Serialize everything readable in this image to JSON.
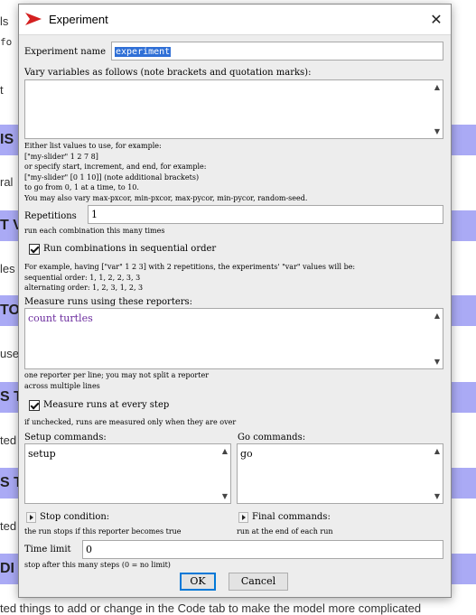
{
  "background": {
    "fragments": [
      "ls",
      "fo",
      "t",
      "ral",
      "les",
      "use",
      "ted",
      "ted"
    ],
    "bands": [
      "IS",
      "T V",
      "TO",
      "S T",
      "S T",
      "DI"
    ],
    "bottom_text": "ted things to add or change in the Code tab to make the model more complicated"
  },
  "dialog": {
    "title": "Experiment",
    "close_glyph": "✕"
  },
  "experiment_name": {
    "label": "Experiment name",
    "value": "experiment"
  },
  "vary_variables": {
    "label": "Vary variables as follows (note brackets and quotation marks):",
    "value": "",
    "help": "Either list values to use, for example:\n[\"my-slider\" 1 2 7 8]\nor specify start, increment, and end, for example:\n[\"my-slider\" [0 1 10]] (note additional brackets)\nto go from 0, 1 at a time, to 10.\nYou may also vary max-pxcor, min-pxcor, max-pycor, min-pycor, random-seed."
  },
  "repetitions": {
    "label": "Repetitions",
    "value": "1",
    "help": "run each combination this many times"
  },
  "sequential": {
    "label": "Run combinations in sequential order",
    "checked": true,
    "help": "For example, having [\"var\" 1 2 3] with 2 repetitions, the experiments' \"var\" values will be:\nsequential order: 1, 1, 2, 2, 3, 3\nalternating order: 1, 2, 3, 1, 2, 3"
  },
  "reporters": {
    "label": "Measure runs using these reporters:",
    "value": "count turtles",
    "help": "one reporter per line; you may not split a reporter\nacross multiple lines"
  },
  "every_step": {
    "label": "Measure runs at every step",
    "checked": true,
    "help": "if unchecked, runs are measured only when they are over"
  },
  "setup": {
    "label": "Setup commands:",
    "value": "setup"
  },
  "go": {
    "label": "Go commands:",
    "value": "go"
  },
  "stop": {
    "label": "Stop condition:",
    "help": "the run stops if this reporter becomes true"
  },
  "final": {
    "label": "Final commands:",
    "help": "run at the end of each run"
  },
  "time_limit": {
    "label": "Time limit",
    "value": "0",
    "help": "stop after this many steps (0 = no limit)"
  },
  "buttons": {
    "ok": "OK",
    "cancel": "Cancel"
  },
  "colors": {
    "accent": "#2f6fd6",
    "reporter_text": "#6b2c9e",
    "band": "#aaaaf5",
    "logo": "#d42020"
  },
  "icons": {
    "logo": "netlogo-arrow-icon",
    "close": "close-icon",
    "scroll_up": "chevron-up-icon",
    "scroll_down": "chevron-down-icon",
    "expand": "triangle-right-icon"
  }
}
